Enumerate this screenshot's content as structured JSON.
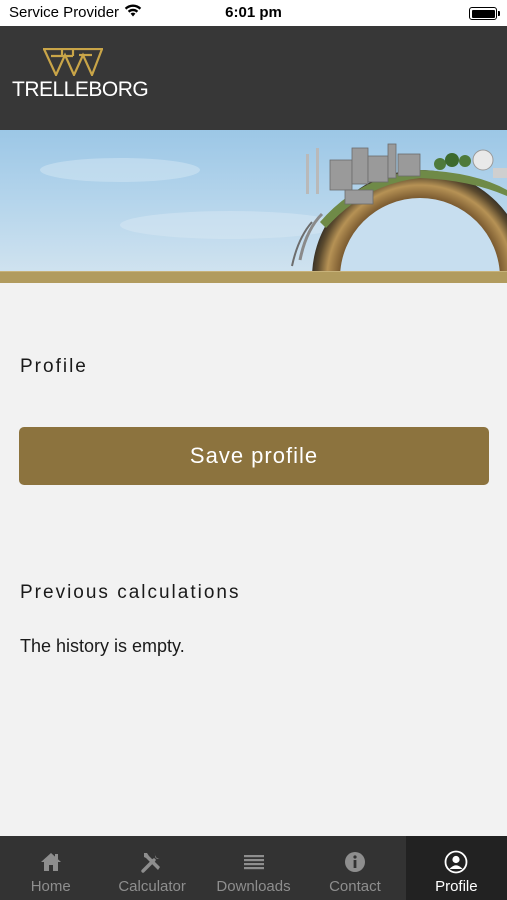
{
  "status_bar": {
    "carrier": "Service Provider",
    "time": "6:01 pm"
  },
  "header": {
    "brand": "TRELLEBORG"
  },
  "profile": {
    "title": "Profile",
    "save_label": "Save profile"
  },
  "history": {
    "title": "Previous calculations",
    "empty_text": "The history is empty."
  },
  "tabs": [
    {
      "label": "Home",
      "icon": "home-icon",
      "active": false
    },
    {
      "label": "Calculator",
      "icon": "tools-icon",
      "active": false
    },
    {
      "label": "Downloads",
      "icon": "list-icon",
      "active": false
    },
    {
      "label": "Contact",
      "icon": "info-icon",
      "active": false
    },
    {
      "label": "Profile",
      "icon": "user-icon",
      "active": true
    }
  ],
  "colors": {
    "header_bg": "#373737",
    "accent": "#8c733e",
    "tab_bar_bg": "#333333",
    "tab_active_bg": "#222222",
    "logo_gold": "#c9a548"
  }
}
